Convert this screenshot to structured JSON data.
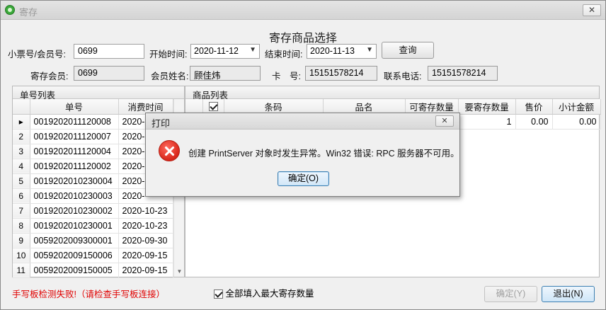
{
  "window": {
    "title": "寄存",
    "close_glyph": "✕"
  },
  "form_title": "寄存商品选择",
  "query": {
    "ticket_label": "小票号/会员号:",
    "ticket_value": "0699",
    "start_label": "开始时间:",
    "start_value": "2020-11-12",
    "end_label": "结束时间:",
    "end_value": "2020-11-13",
    "query_button": "查询"
  },
  "member": {
    "member_label": "寄存会员:",
    "member_value": "0699",
    "name_label": "会员姓名:",
    "name_value": "顾佳炜",
    "card_label": "卡　号:",
    "card_value": "15151578214",
    "phone_label": "联系电话:",
    "phone_value": "15151578214"
  },
  "order_list": {
    "title": "单号列表",
    "columns": [
      "单号",
      "消费时间"
    ],
    "rows": [
      {
        "rn": "▸",
        "no": "0019202011120008",
        "time": "2020-"
      },
      {
        "rn": "2",
        "no": "0019202011120007",
        "time": "2020-"
      },
      {
        "rn": "3",
        "no": "0019202011120004",
        "time": "2020-"
      },
      {
        "rn": "4",
        "no": "0019202011120002",
        "time": "2020-"
      },
      {
        "rn": "5",
        "no": "0019202010230004",
        "time": "2020-"
      },
      {
        "rn": "6",
        "no": "0019202010230003",
        "time": "2020-"
      },
      {
        "rn": "7",
        "no": "0019202010230002",
        "time": "2020-10-23"
      },
      {
        "rn": "8",
        "no": "0019202010230001",
        "time": "2020-10-23"
      },
      {
        "rn": "9",
        "no": "0059202009300001",
        "time": "2020-09-30"
      },
      {
        "rn": "10",
        "no": "0059202009150006",
        "time": "2020-09-15"
      },
      {
        "rn": "11",
        "no": "0059202009150005",
        "time": "2020-09-15"
      }
    ]
  },
  "goods_list": {
    "title": "商品列表",
    "columns": [
      "条码",
      "品名",
      "可寄存数量",
      "要寄存数量",
      "售价",
      "小计金额"
    ],
    "rows": [
      {
        "barcode": "",
        "name": "",
        "avail": "",
        "qty": "1",
        "price": "0.00",
        "subtotal": "0.00"
      }
    ]
  },
  "footer": {
    "warning": "手写板检测失败!（请检查手写板连接）",
    "fill_max_label": "全部填入最大寄存数量",
    "confirm_button": "确定(Y)",
    "exit_button": "退出(N)"
  },
  "dialog": {
    "title": "打印",
    "message": "创建 PrintServer 对象时发生异常。Win32 错误: RPC 服务器不可用。",
    "ok_button": "确定(O)",
    "close_glyph": "✕"
  },
  "colors": {
    "warning_text": "#e00000",
    "error_icon": "#d8261a",
    "primary_border": "#3c7fb1"
  },
  "icons": {
    "app": "app-logo-icon",
    "error": "error-x-icon",
    "dropdown": "chevron-down-icon"
  }
}
